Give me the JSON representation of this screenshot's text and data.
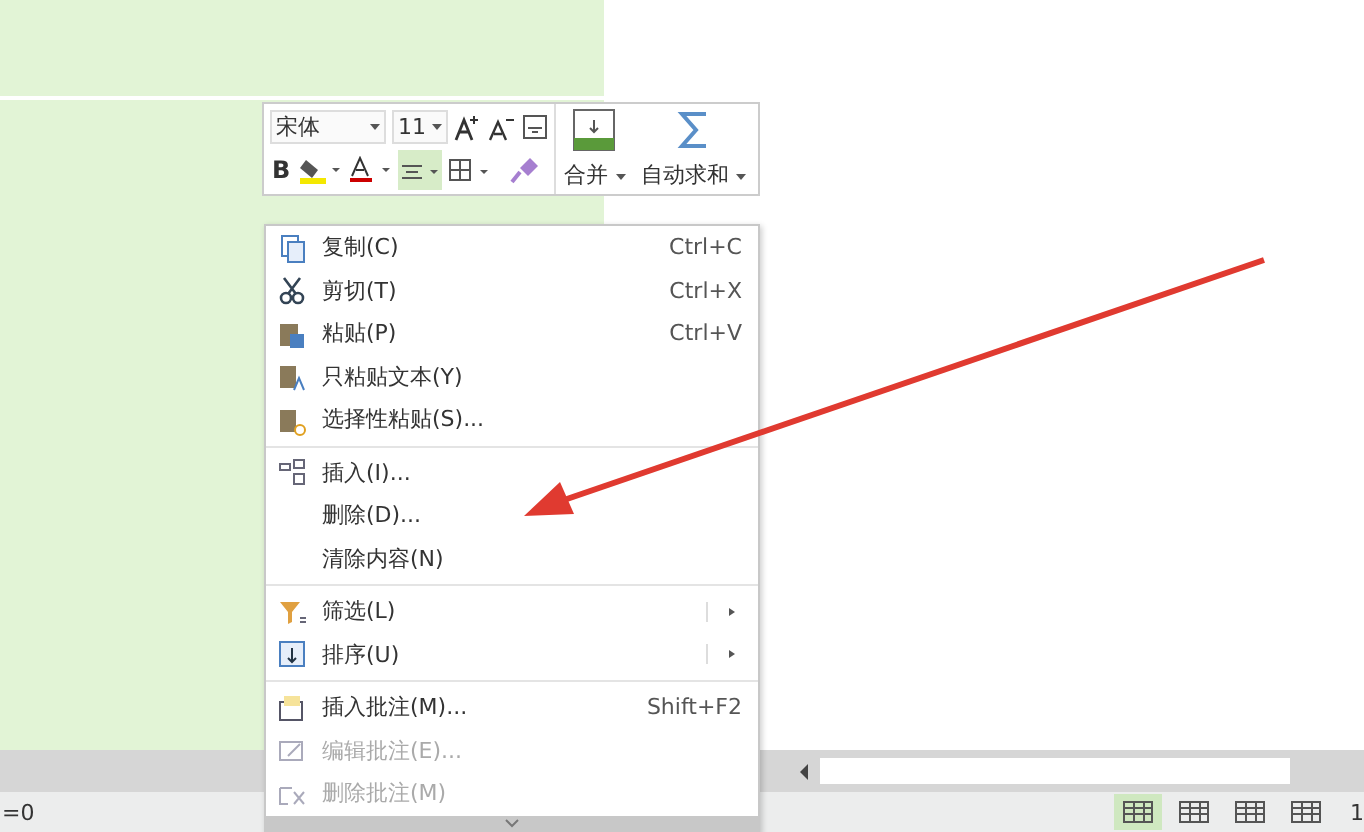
{
  "mini_toolbar": {
    "font": "宋体",
    "size": "11",
    "bold": "B",
    "center_align_selected": true,
    "merge": "合并",
    "autosum": "自动求和"
  },
  "context_menu": {
    "items": [
      {
        "kind": "item",
        "label": "复制(C)",
        "shortcut": "Ctrl+C",
        "disabled": false,
        "submenu": false
      },
      {
        "kind": "item",
        "label": "剪切(T)",
        "shortcut": "Ctrl+X",
        "disabled": false,
        "submenu": false
      },
      {
        "kind": "item",
        "label": "粘贴(P)",
        "shortcut": "Ctrl+V",
        "disabled": false,
        "submenu": false
      },
      {
        "kind": "item",
        "label": "只粘贴文本(Y)",
        "disabled": false,
        "submenu": false
      },
      {
        "kind": "item",
        "label": "选择性粘贴(S)...",
        "disabled": false,
        "submenu": false
      },
      {
        "kind": "separator"
      },
      {
        "kind": "item",
        "label": "插入(I)...",
        "disabled": false,
        "submenu": false
      },
      {
        "kind": "item",
        "label": "删除(D)...",
        "disabled": false,
        "submenu": false
      },
      {
        "kind": "item",
        "label": "清除内容(N)",
        "disabled": false,
        "submenu": false
      },
      {
        "kind": "separator"
      },
      {
        "kind": "item",
        "label": "筛选(L)",
        "disabled": false,
        "submenu": true
      },
      {
        "kind": "item",
        "label": "排序(U)",
        "disabled": false,
        "submenu": true
      },
      {
        "kind": "separator"
      },
      {
        "kind": "item",
        "label": "插入批注(M)...",
        "shortcut": "Shift+F2",
        "disabled": false,
        "submenu": false
      },
      {
        "kind": "item",
        "label": "编辑批注(E)...",
        "disabled": true,
        "submenu": false
      },
      {
        "kind": "item",
        "label": "删除批注(M)",
        "disabled": true,
        "submenu": false
      }
    ]
  },
  "status_bar": {
    "formula": "=0",
    "page": "1",
    "view_buttons": [
      {
        "selected": true
      },
      {
        "selected": false
      },
      {
        "selected": false
      },
      {
        "selected": false
      }
    ]
  }
}
